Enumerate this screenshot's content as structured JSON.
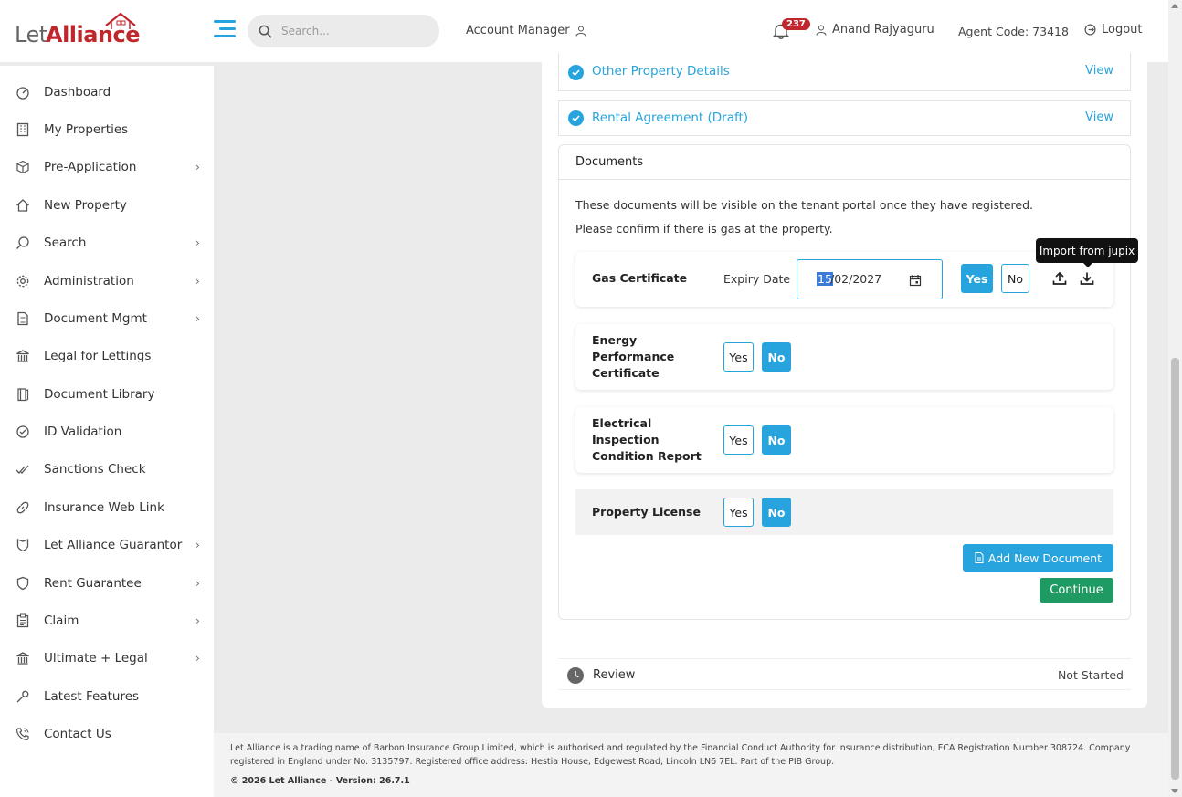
{
  "brand": {
    "let": "Let",
    "alliance": "Alliance"
  },
  "header": {
    "search_placeholder": "Search...",
    "account_manager": "Account Manager",
    "notification_count": "237",
    "user_name": "Anand Rajyaguru",
    "agent_code": "Agent Code: 73418",
    "logout": "Logout"
  },
  "sidebar": {
    "items": [
      {
        "label": "Dashboard",
        "icon": "dashboard-icon",
        "has_children": false
      },
      {
        "label": "My Properties",
        "icon": "building-icon",
        "has_children": false
      },
      {
        "label": "Pre-Application",
        "icon": "box-icon",
        "has_children": true
      },
      {
        "label": "New Property",
        "icon": "home-icon",
        "has_children": false
      },
      {
        "label": "Search",
        "icon": "search-icon",
        "has_children": true
      },
      {
        "label": "Administration",
        "icon": "gear-icon",
        "has_children": true
      },
      {
        "label": "Document Mgmt",
        "icon": "document-icon",
        "has_children": true
      },
      {
        "label": "Legal for Lettings",
        "icon": "bank-icon",
        "has_children": false
      },
      {
        "label": "Document Library",
        "icon": "book-icon",
        "has_children": false
      },
      {
        "label": "ID Validation",
        "icon": "check-circle-icon",
        "has_children": false
      },
      {
        "label": "Sanctions Check",
        "icon": "double-check-icon",
        "has_children": false
      },
      {
        "label": "Insurance Web Link",
        "icon": "link-icon",
        "has_children": false
      },
      {
        "label": "Let Alliance Guarantor",
        "icon": "shield-icon",
        "has_children": true
      },
      {
        "label": "Rent Guarantee",
        "icon": "shield-outline-icon",
        "has_children": true
      },
      {
        "label": "Claim",
        "icon": "clipboard-icon",
        "has_children": true
      },
      {
        "label": "Ultimate + Legal",
        "icon": "bank-icon",
        "has_children": true
      },
      {
        "label": "Latest Features",
        "icon": "wrench-icon",
        "has_children": false
      },
      {
        "label": "Contact Us",
        "icon": "phone-icon",
        "has_children": false
      }
    ]
  },
  "sections": {
    "other_property": {
      "title": "Other Property Details",
      "action": "View"
    },
    "rental_agreement": {
      "title": "Rental Agreement (Draft)",
      "action": "View"
    }
  },
  "documents": {
    "heading": "Documents",
    "info_line1": "These documents will be visible on the tenant portal once they have registered.",
    "info_line2": "Please confirm if there is gas at the property.",
    "gas": {
      "name": "Gas Certificate",
      "expiry_label": "Expiry Date",
      "date_selected": "15",
      "date_rest": "/02/2027",
      "yes": "Yes",
      "no": "No",
      "selected": "Yes"
    },
    "tooltip": "Import from jupix",
    "epc": {
      "line1": "Energy",
      "line2": "Performance",
      "line3": "Certificate",
      "yes": "Yes",
      "no": "No",
      "selected": "No"
    },
    "eicr": {
      "line1": "Electrical",
      "line2": "Inspection",
      "line3": "Condition Report",
      "yes": "Yes",
      "no": "No",
      "selected": "No"
    },
    "license": {
      "name": "Property License",
      "yes": "Yes",
      "no": "No",
      "selected": "No"
    },
    "add_button": "Add New Document",
    "continue_button": "Continue"
  },
  "review": {
    "title": "Review",
    "status": "Not Started"
  },
  "footer": {
    "legal": "Let Alliance is a trading name of Barbon Insurance Group Limited, which is authorised and regulated by the Financial Conduct Authority for insurance distribution, FCA Registration Number 308724. Company registered in England under No. 3135797. Registered office address: Hestia House, Edgewest Road, Lincoln LN6 7EL. Part of the PIB Group.",
    "version": "© 2026 Let Alliance - Version: 26.7.1"
  },
  "colors": {
    "accent": "#27a4dd",
    "brand_red": "#c0272d",
    "continue_green": "#1e9a62"
  }
}
